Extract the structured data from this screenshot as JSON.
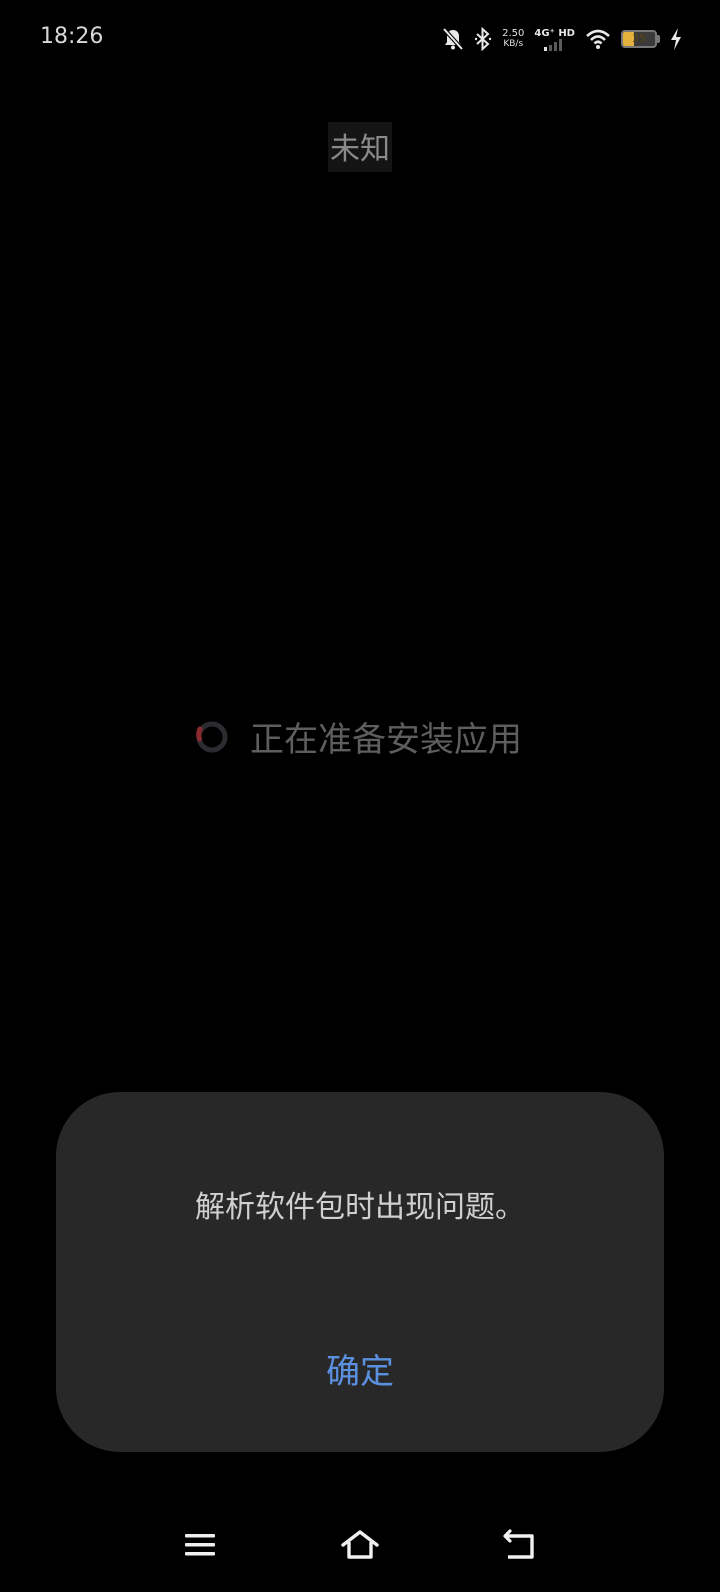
{
  "status_bar": {
    "time": "18:26",
    "net_speed_value": "2.50",
    "net_speed_unit": "KB/s",
    "network_label": "4G⁺ HD",
    "battery_level": "35",
    "battery_fill_color": "#e3b23c",
    "icons": [
      "bell-muted-icon",
      "bluetooth-icon",
      "wifi-icon",
      "charging-bolt-icon"
    ]
  },
  "app": {
    "title": "未知",
    "preparing_text": "正在准备安装应用"
  },
  "dialog": {
    "message": "解析软件包时出现问题。",
    "ok_label": "确定",
    "ok_color": "#5b8fe0",
    "background": "#282828"
  },
  "nav_bar": {
    "icons": [
      "menu-icon",
      "home-icon",
      "back-icon"
    ]
  }
}
